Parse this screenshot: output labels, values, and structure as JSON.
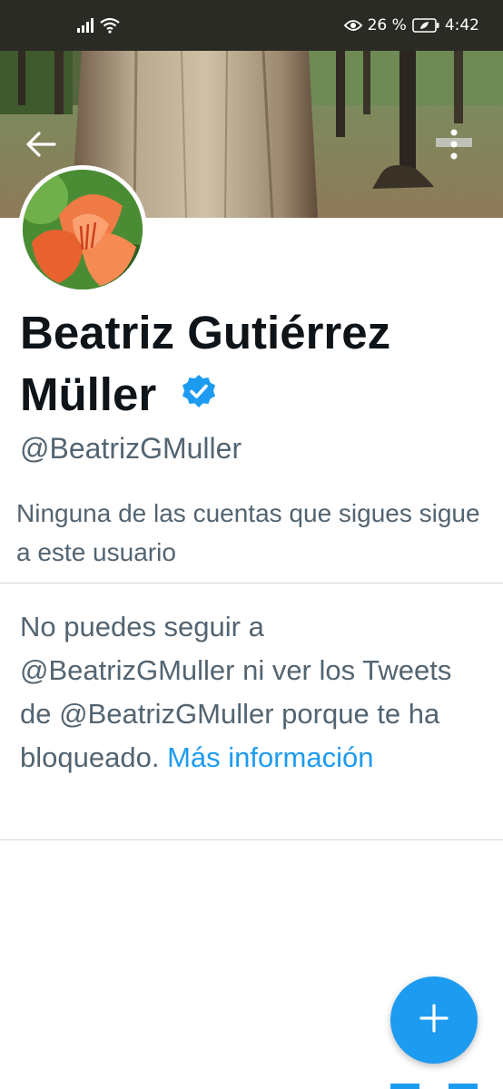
{
  "status_bar": {
    "battery_percent": "26 %",
    "time": "4:42",
    "icons": [
      "signal-icon",
      "wifi-icon",
      "eye-comfort-icon",
      "battery-saver-icon"
    ]
  },
  "header": {
    "back_icon": "arrow-left-icon",
    "more_icon": "more-vertical-icon"
  },
  "profile": {
    "name": "Beatriz Gutiérrez Müller",
    "name_line1": "Beatriz Gutiérrez",
    "name_line2": "Müller",
    "verified_icon": "verified-badge-icon",
    "handle": "@BeatrizGMuller",
    "followers_note": "Ninguna de las cuentas que sigues sigue a este usuario"
  },
  "blocked": {
    "message": "No puedes seguir a @BeatrizGMuller ni ver los Tweets de @BeatrizGMuller porque te ha bloqueado.",
    "link_text": "Más información"
  },
  "fab": {
    "icon": "plus-icon"
  },
  "colors": {
    "accent": "#1d9bf0",
    "text_primary": "#0f1419",
    "text_secondary": "#536471",
    "status_bar_bg": "#2b2b25"
  }
}
